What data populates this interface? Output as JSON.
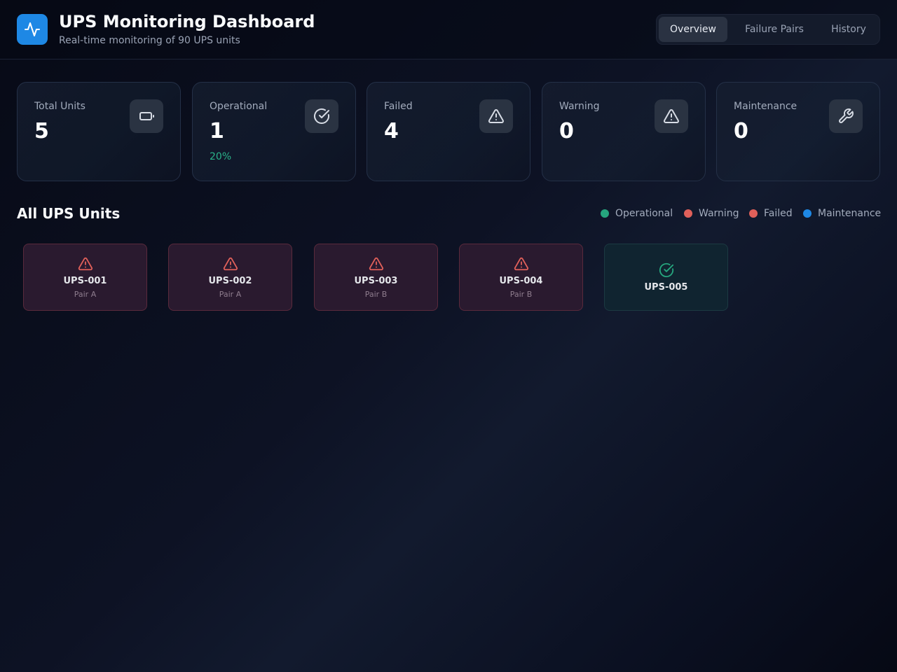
{
  "header": {
    "title": "UPS Monitoring Dashboard",
    "subtitle": "Real-time monitoring of 90 UPS units",
    "logo_icon": "activity-pulse-icon",
    "accent_color": "#1e88e5"
  },
  "tabs": [
    {
      "label": "Overview",
      "active": true
    },
    {
      "label": "Failure Pairs",
      "active": false
    },
    {
      "label": "History",
      "active": false
    }
  ],
  "stats": [
    {
      "label": "Total Units",
      "value": "5",
      "sub": "",
      "icon": "battery-icon"
    },
    {
      "label": "Operational",
      "value": "1",
      "sub": "20%",
      "icon": "check-circle-icon"
    },
    {
      "label": "Failed",
      "value": "4",
      "sub": "",
      "icon": "alert-triangle-icon"
    },
    {
      "label": "Warning",
      "value": "0",
      "sub": "",
      "icon": "alert-triangle-icon"
    },
    {
      "label": "Maintenance",
      "value": "0",
      "sub": "",
      "icon": "wrench-icon"
    }
  ],
  "units_section": {
    "title": "All UPS Units",
    "legend": [
      {
        "label": "Operational",
        "color": "#26a67e"
      },
      {
        "label": "Warning",
        "color": "#e0605a"
      },
      {
        "label": "Failed",
        "color": "#e0605a"
      },
      {
        "label": "Maintenance",
        "color": "#1e88e5"
      }
    ]
  },
  "units": [
    {
      "name": "UPS-001",
      "pair": "Pair A",
      "status": "failed",
      "icon": "alert-triangle-icon"
    },
    {
      "name": "UPS-002",
      "pair": "Pair A",
      "status": "failed",
      "icon": "alert-triangle-icon"
    },
    {
      "name": "UPS-003",
      "pair": "Pair B",
      "status": "failed",
      "icon": "alert-triangle-icon"
    },
    {
      "name": "UPS-004",
      "pair": "Pair B",
      "status": "failed",
      "icon": "alert-triangle-icon"
    },
    {
      "name": "UPS-005",
      "pair": "",
      "status": "operational",
      "icon": "check-circle-icon"
    }
  ],
  "colors": {
    "failed": "#e0605a",
    "operational": "#26a67e",
    "icon_neutral": "#d7dce5"
  }
}
